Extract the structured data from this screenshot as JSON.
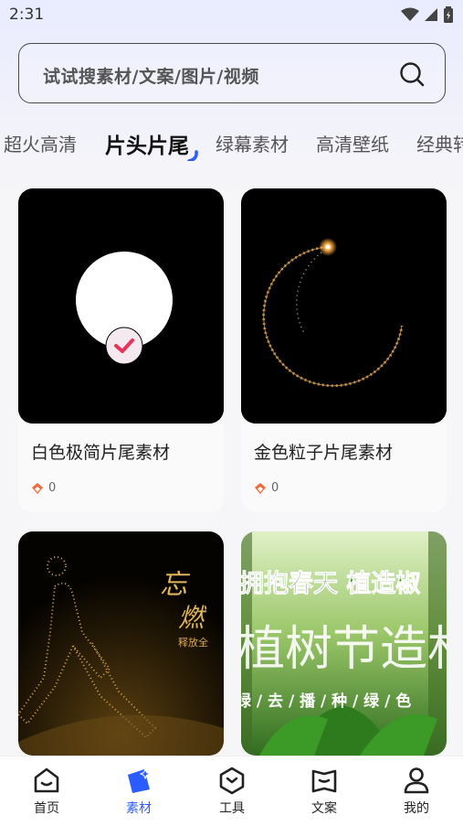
{
  "status_bar": {
    "time": "2:31"
  },
  "search": {
    "placeholder": "试试搜素材/文案/图片/视频"
  },
  "tabs": [
    {
      "label": "超火高清"
    },
    {
      "label": "片头片尾",
      "active": true
    },
    {
      "label": "绿幕素材"
    },
    {
      "label": "高清壁纸"
    },
    {
      "label": "经典转"
    }
  ],
  "cards": [
    {
      "title": "白色极简片尾素材",
      "count": "0"
    },
    {
      "title": "金色粒子片尾素材",
      "count": "0"
    },
    {
      "title": "",
      "count": ""
    },
    {
      "title": "",
      "count": ""
    }
  ],
  "card_art": {
    "card3_text_1": "忘",
    "card3_text_2": "燃",
    "card3_text_3": "释放全",
    "card4_line_1": "拥抱春天 植造椒",
    "card4_line_2": "植树节造林",
    "card4_line_3": "绿 / 去 / 播 / 种 / 绿 / 色"
  },
  "nav": [
    {
      "label": "首页",
      "icon": "home-icon"
    },
    {
      "label": "素材",
      "icon": "material-icon",
      "active": true
    },
    {
      "label": "工具",
      "icon": "tools-icon"
    },
    {
      "label": "文案",
      "icon": "copywriting-icon"
    },
    {
      "label": "我的",
      "icon": "profile-icon"
    }
  ],
  "colors": {
    "accent": "#2a5cff",
    "check": "#e8335a",
    "gold": "#e0b45a"
  }
}
